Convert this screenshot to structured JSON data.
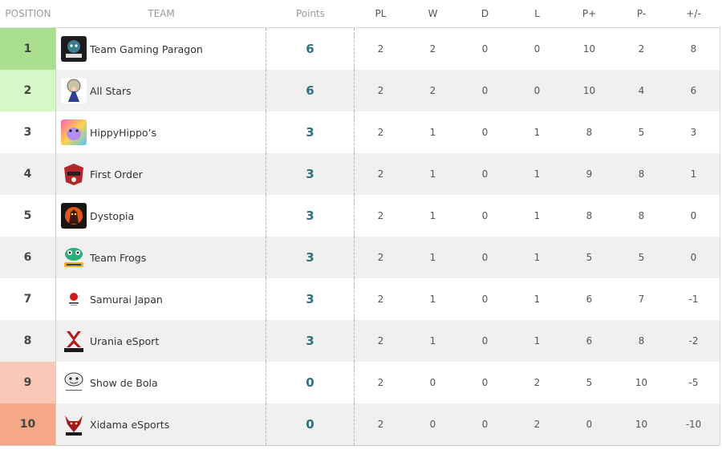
{
  "headers": {
    "position": "POSITION",
    "team": "TEAM",
    "points": "Points",
    "pl": "PL",
    "w": "W",
    "d": "D",
    "l": "L",
    "pplus": "P+",
    "pminus": "P-",
    "diff": "+/-"
  },
  "colors": {
    "pos1": "#a9df8f",
    "pos2": "#d8f7c8",
    "pos9": "#fbc8b8",
    "pos10": "#f5a888",
    "points": "#2e6f80"
  },
  "rows": [
    {
      "pos": "1",
      "team": "Team Gaming Paragon",
      "logo": "team-gaming-paragon-logo",
      "points": "6",
      "pl": "2",
      "w": "2",
      "d": "0",
      "l": "0",
      "pplus": "10",
      "pminus": "2",
      "diff": "8"
    },
    {
      "pos": "2",
      "team": "All Stars",
      "logo": "all-stars-logo",
      "points": "6",
      "pl": "2",
      "w": "2",
      "d": "0",
      "l": "0",
      "pplus": "10",
      "pminus": "4",
      "diff": "6"
    },
    {
      "pos": "3",
      "team": "HippyHippo’s",
      "logo": "hippyhippos-logo",
      "points": "3",
      "pl": "2",
      "w": "1",
      "d": "0",
      "l": "1",
      "pplus": "8",
      "pminus": "5",
      "diff": "3"
    },
    {
      "pos": "4",
      "team": "First Order",
      "logo": "first-order-logo",
      "points": "3",
      "pl": "2",
      "w": "1",
      "d": "0",
      "l": "1",
      "pplus": "9",
      "pminus": "8",
      "diff": "1"
    },
    {
      "pos": "5",
      "team": "Dystopia",
      "logo": "dystopia-logo",
      "points": "3",
      "pl": "2",
      "w": "1",
      "d": "0",
      "l": "1",
      "pplus": "8",
      "pminus": "8",
      "diff": "0"
    },
    {
      "pos": "6",
      "team": "Team Frogs",
      "logo": "team-frogs-logo",
      "points": "3",
      "pl": "2",
      "w": "1",
      "d": "0",
      "l": "1",
      "pplus": "5",
      "pminus": "5",
      "diff": "0"
    },
    {
      "pos": "7",
      "team": "Samurai Japan",
      "logo": "samurai-japan-logo",
      "points": "3",
      "pl": "2",
      "w": "1",
      "d": "0",
      "l": "1",
      "pplus": "6",
      "pminus": "7",
      "diff": "-1"
    },
    {
      "pos": "8",
      "team": "Urania eSport",
      "logo": "urania-esport-logo",
      "points": "3",
      "pl": "2",
      "w": "1",
      "d": "0",
      "l": "1",
      "pplus": "6",
      "pminus": "8",
      "diff": "-2"
    },
    {
      "pos": "9",
      "team": "Show de Bola",
      "logo": "show-de-bola-logo",
      "points": "0",
      "pl": "2",
      "w": "0",
      "d": "0",
      "l": "2",
      "pplus": "5",
      "pminus": "10",
      "diff": "-5"
    },
    {
      "pos": "10",
      "team": "Xidama eSports",
      "logo": "xidama-esports-logo",
      "points": "0",
      "pl": "2",
      "w": "0",
      "d": "0",
      "l": "2",
      "pplus": "0",
      "pminus": "10",
      "diff": "-10"
    }
  ]
}
